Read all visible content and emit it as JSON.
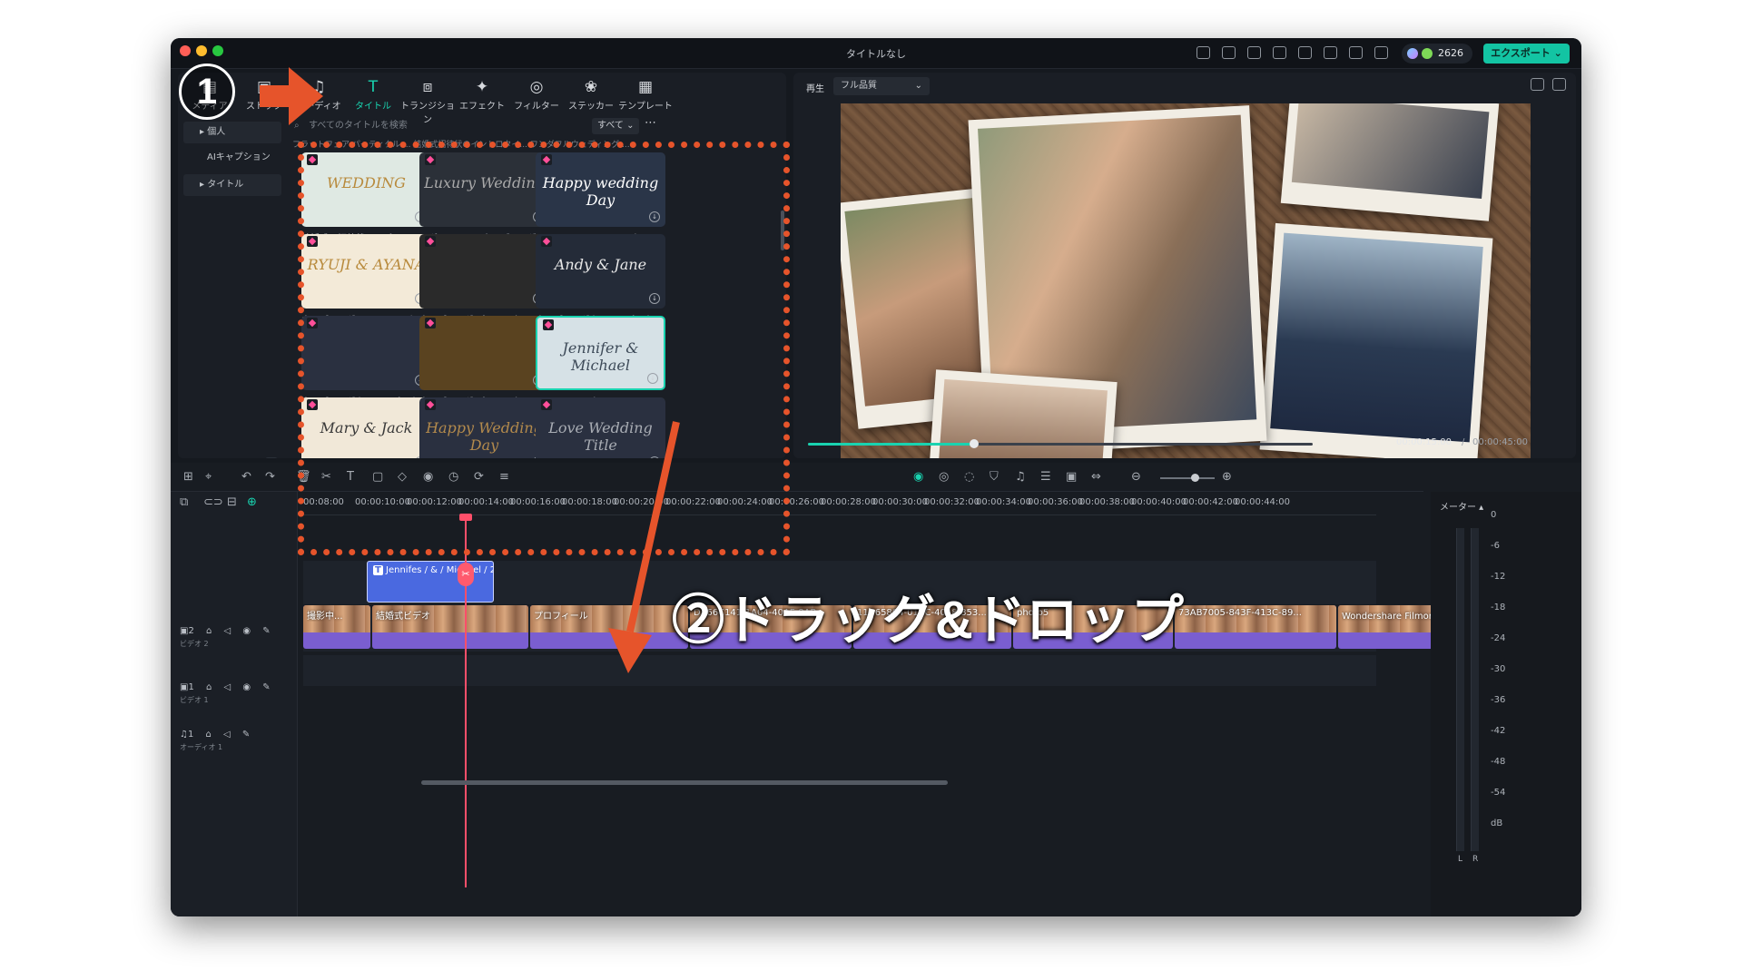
{
  "window": {
    "title": "タイトルなし",
    "coins": "2626",
    "export_label": "エクスポート"
  },
  "tabs": [
    {
      "label": "メディア",
      "icon": "media-icon"
    },
    {
      "label": "ストック",
      "icon": "stock-icon"
    },
    {
      "label": "オーディオ",
      "icon": "audio-icon"
    },
    {
      "label": "タイトル",
      "icon": "title-T-icon"
    },
    {
      "label": "トランジション",
      "icon": "transition-icon"
    },
    {
      "label": "エフェクト",
      "icon": "effect-icon"
    },
    {
      "label": "フィルター",
      "icon": "filter-icon"
    },
    {
      "label": "ステッカー",
      "icon": "sticker-icon"
    },
    {
      "label": "テンプレート",
      "icon": "template-icon"
    }
  ],
  "sidebar": {
    "items": [
      {
        "label": "個人"
      },
      {
        "label": "AIキャプション"
      },
      {
        "label": "タイトル"
      }
    ]
  },
  "search": {
    "placeholder": "すべてのタイトルを検索",
    "filter": "すべて"
  },
  "cut_row_text": "フラットフェア パーティクル ...   結婚式招待状のイントロタイ...   ワンダフルウェディング ...",
  "cards": [
    {
      "label": "結婚式の招待状テンプレート ...",
      "text": "WEDDING",
      "bg": "#dfe9e3",
      "fg": "#b88a3c"
    },
    {
      "label": "ラグジュアリーウェディング...",
      "text": "Luxury Wedding",
      "bg": "#2b3038",
      "fg": "#a9a9a9"
    },
    {
      "label": "Happy Wedding Day タイ...",
      "text": "Happy wedding Day",
      "bg": "#2a3548",
      "fg": "#ffffff"
    },
    {
      "label": "ウェディング フローラルバッ...",
      "text": "RYUJI & AYANA",
      "bg": "#f3ead8",
      "fg": "#b88a3c"
    },
    {
      "label": "ウェディング パーティクル ...",
      "text": "",
      "bg": "#2a2a2a",
      "fg": "#d8b56a"
    },
    {
      "label": "ウェディングタイトルパック ...",
      "text": "Andy & Jane",
      "bg": "#242b38",
      "fg": "#e8e8e8"
    },
    {
      "label": "ウェディングタイトルパック ...",
      "text": "",
      "bg": "#2a3040",
      "fg": "#dcdcdc"
    },
    {
      "label": "ウェディング パーティクル ...",
      "text": "",
      "bg": "#5a4320",
      "fg": "#d8b56a"
    },
    {
      "label": "フローラル・タイトル 2",
      "text": "Jennifer & Michael",
      "bg": "#d6e1e6",
      "fg": "#3d4a58"
    },
    {
      "label": "",
      "text": "Mary & Jack",
      "bg": "#f1e8d8",
      "fg": "#3a3a3a"
    },
    {
      "label": "",
      "text": "Happy Wedding Day",
      "bg": "#2a3040",
      "fg": "#b38a4c"
    },
    {
      "label": "",
      "text": "Love Wedding Title",
      "bg": "#2a3040",
      "fg": "#a9adb4"
    }
  ],
  "preview": {
    "label": "再生",
    "quality": "フル品質",
    "current": "00:00:15:00",
    "separator": "/",
    "total": "00:00:45:00",
    "progress": 0.33
  },
  "ruler": [
    "00:08:00",
    "00:00:10:00",
    "00:00:12:00",
    "00:00:14:00",
    "00:00:16:00",
    "00:00:18:00",
    "00:00:20:00",
    "00:00:22:00",
    "00:00:24:00",
    "00:00:26:00",
    "00:00:28:00",
    "00:00:30:00",
    "00:00:32:00",
    "00:00:34:00",
    "00:00:36:00",
    "00:00:38:00",
    "00:00:40:00",
    "00:00:42:00",
    "00:00:44:00"
  ],
  "tracks": [
    {
      "name": "2",
      "sub": "ビデオ 2"
    },
    {
      "name": "1",
      "sub": "ビデオ 1"
    },
    {
      "name": "1",
      "sub": "オーディオ 1"
    }
  ],
  "title_clip": "Jennifes / & / Michael / 25.0...",
  "video_clips": [
    "撮影中...",
    "結婚式ビデオ",
    "プロフィール",
    "DA66C141-1A04-40AF-8AB...",
    "11C65804-01BC-4048-853...",
    "photo5",
    "73AB7005-843F-413C-89...",
    "Wondershare Filmoraお..."
  ],
  "meter": {
    "title": "メーター",
    "scale": [
      "0",
      "-6",
      "-12",
      "-18",
      "-24",
      "-30",
      "-36",
      "-42",
      "-48",
      "-54",
      "dB"
    ],
    "left": "L",
    "right": "R"
  },
  "annotations": {
    "step1": "1",
    "step2": "②ドラッグ&ドロップ",
    "arrow_color": "#e6542b"
  }
}
